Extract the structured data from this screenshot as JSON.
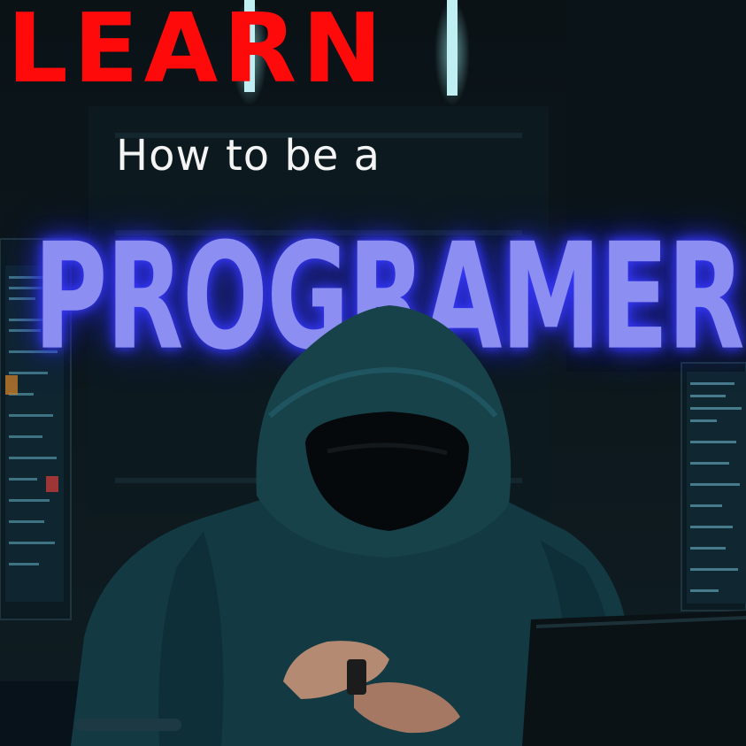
{
  "title": {
    "learn": "LEARN",
    "subtitle": "How to be a",
    "main": "PROGRAMER"
  },
  "colors": {
    "learn": "#ff0a0a",
    "subtitle": "#f4f4f4",
    "main": "#8c8ef2",
    "glow": "#3a3cff",
    "background": "#0b141a",
    "hoodie": "#17424a",
    "neon": "#bfeff2"
  },
  "icons": [
    "hooded-figure-illustration",
    "monitor-left-illustration",
    "monitor-right-illustration",
    "laptop-illustration",
    "ceiling-neon-lights"
  ]
}
